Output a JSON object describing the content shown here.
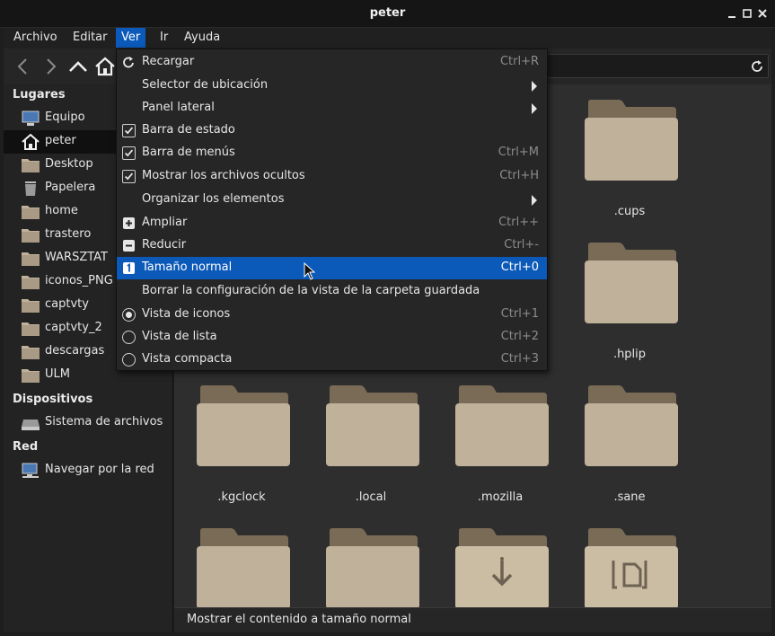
{
  "window": {
    "title": "peter"
  },
  "menubar": {
    "items": [
      "Archivo",
      "Editar",
      "Ver",
      "Ir",
      "Ayuda"
    ],
    "active": "Ver"
  },
  "sidebar": {
    "lugares_heading": "Lugares",
    "places": [
      {
        "label": "Equipo",
        "icon": "computer-icon"
      },
      {
        "label": "peter",
        "icon": "home-icon",
        "selected": true
      },
      {
        "label": "Desktop",
        "icon": "folder-icon"
      },
      {
        "label": "Papelera",
        "icon": "trash-icon"
      },
      {
        "label": "home",
        "icon": "folder-icon"
      },
      {
        "label": "trastero",
        "icon": "folder-icon"
      },
      {
        "label": "WARSZTAT",
        "icon": "folder-icon"
      },
      {
        "label": "iconos_PNG",
        "icon": "folder-icon"
      },
      {
        "label": "captvty",
        "icon": "folder-icon"
      },
      {
        "label": "captvty_2",
        "icon": "folder-icon"
      },
      {
        "label": "descargas",
        "icon": "folder-icon"
      },
      {
        "label": "ULM",
        "icon": "folder-icon"
      }
    ],
    "dispositivos_heading": "Dispositivos",
    "devices": [
      {
        "label": "Sistema de archivos",
        "icon": "drive-icon"
      }
    ],
    "red_heading": "Red",
    "network": [
      {
        "label": "Navegar por la red",
        "icon": "network-icon"
      }
    ]
  },
  "view_menu": {
    "items": [
      {
        "label": "Recargar",
        "accel": "Ctrl+R",
        "lead": "reload"
      },
      {
        "label": "Selector de ubicación",
        "submenu": true
      },
      {
        "label": "Panel lateral",
        "submenu": true
      },
      {
        "label": "Barra de estado",
        "lead": "check"
      },
      {
        "label": "Barra de menús",
        "accel": "Ctrl+M",
        "lead": "check"
      },
      {
        "label": "Mostrar los archivos ocultos",
        "accel": "Ctrl+H",
        "lead": "check"
      },
      {
        "label": "Organizar los elementos",
        "submenu": true
      },
      {
        "label": "Ampliar",
        "accel": "Ctrl++",
        "lead": "zoom-in"
      },
      {
        "label": "Reducir",
        "accel": "Ctrl+-",
        "lead": "zoom-out"
      },
      {
        "label": "Tamaño normal",
        "accel": "Ctrl+0",
        "lead": "zoom-normal",
        "highlighted": true
      },
      {
        "label": "Borrar la configuración de la vista de la carpeta guardada"
      },
      {
        "label": "Vista de iconos",
        "accel": "Ctrl+1",
        "lead": "radio-on"
      },
      {
        "label": "Vista de lista",
        "accel": "Ctrl+2",
        "lead": "radio"
      },
      {
        "label": "Vista compacta",
        "accel": "Ctrl+3",
        "lead": "radio"
      }
    ]
  },
  "files": [
    {
      "name": ".cups"
    },
    {
      "name": ".hplip"
    },
    {
      "name": ".kgclock"
    },
    {
      "name": ".local"
    },
    {
      "name": ".mozilla"
    },
    {
      "name": ".sane"
    },
    {
      "name": ""
    },
    {
      "name": ""
    },
    {
      "name": "",
      "icon": "download-folder-icon"
    },
    {
      "name": "",
      "icon": "documents-folder-icon"
    }
  ],
  "statusbar": {
    "text": "Mostrar el contenido a tamaño normal"
  },
  "colors": {
    "accent": "#0b59b8",
    "folder": "#bfb19a",
    "folder_tab": "#7a6b57"
  }
}
